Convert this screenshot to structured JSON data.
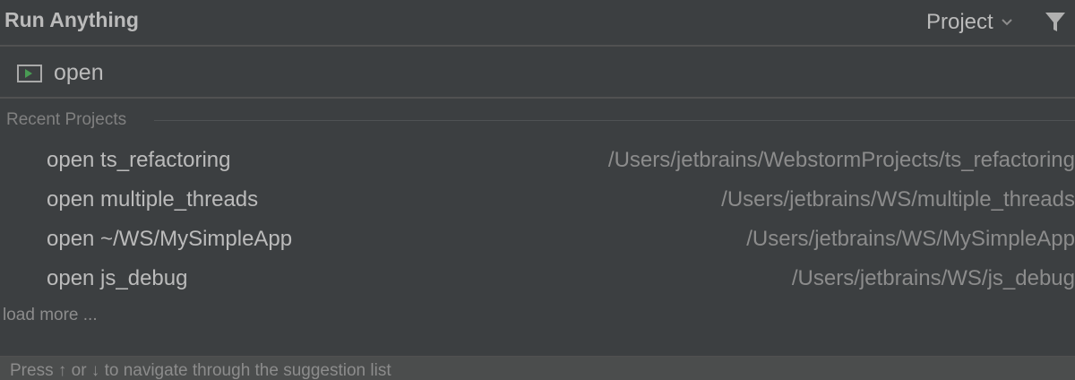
{
  "header": {
    "title": "Run Anything",
    "scope_label": "Project"
  },
  "search": {
    "value": "open"
  },
  "group": {
    "label": "Recent Projects"
  },
  "items": [
    {
      "command": "open ts_refactoring",
      "path": "/Users/jetbrains/WebstormProjects/ts_refactoring"
    },
    {
      "command": "open multiple_threads",
      "path": "/Users/jetbrains/WS/multiple_threads"
    },
    {
      "command": "open ~/WS/MySimpleApp",
      "path": "/Users/jetbrains/WS/MySimpleApp"
    },
    {
      "command": "open js_debug",
      "path": "/Users/jetbrains/WS/js_debug"
    }
  ],
  "load_more_label": "load more ...",
  "footer": {
    "hint": "Press ↑ or ↓ to navigate through the suggestion list"
  },
  "icons": {
    "run": "run-icon",
    "scope_dropdown": "chevron-down-icon",
    "filter": "filter-icon"
  },
  "colors": {
    "background": "#3c3f41",
    "text": "#bbbbbb",
    "muted": "#8c8c8c",
    "run_icon_green": "#499c54"
  }
}
